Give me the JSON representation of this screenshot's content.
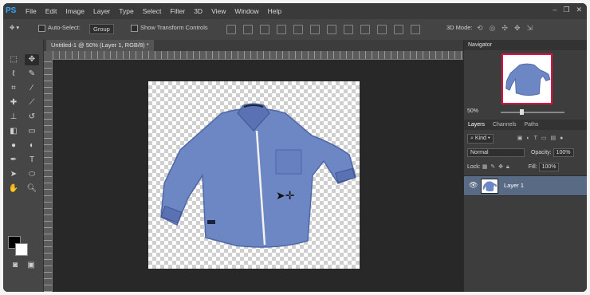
{
  "menubar": {
    "logo": "PS",
    "items": [
      "File",
      "Edit",
      "Image",
      "Layer",
      "Type",
      "Select",
      "Filter",
      "3D",
      "View",
      "Window",
      "Help"
    ]
  },
  "options": {
    "auto_select_label": "Auto-Select:",
    "auto_select_value": "Group",
    "show_transform_label": "Show Transform Controls",
    "mode3d_label": "3D Mode:"
  },
  "document": {
    "tab_title": "Untitled-1 @ 50% (Layer 1, RGB/8) *",
    "ruler_marks": [
      "6",
      "4",
      "2",
      "0",
      "2",
      "4",
      "6",
      "8",
      "10",
      "12",
      "14",
      "16",
      "18",
      "20",
      "22"
    ]
  },
  "navigator": {
    "title": "Navigator",
    "zoom": "50%"
  },
  "layers_panel": {
    "tabs": [
      "Layers",
      "Channels",
      "Paths"
    ],
    "kind_label": "Kind",
    "blend_mode": "Normal",
    "opacity_label": "Opacity:",
    "opacity_value": "100%",
    "lock_label": "Lock:",
    "fill_label": "Fill:",
    "fill_value": "100%",
    "layer_name": "Layer 1"
  },
  "colors": {
    "shirt": "#6d86c4",
    "shirt_dark": "#4f67a6",
    "selected_layer": "#596a85",
    "accent": "#31a8ff"
  },
  "icons": [
    "move-icon",
    "marquee-icon",
    "lasso-icon",
    "quick-select-icon",
    "crop-icon",
    "eyedropper-icon",
    "healing-brush-icon",
    "brush-icon",
    "clone-stamp-icon",
    "history-brush-icon",
    "eraser-icon",
    "gradient-icon",
    "blur-icon",
    "dodge-icon",
    "pen-icon",
    "type-icon",
    "path-select-icon",
    "shape-icon",
    "hand-icon",
    "zoom-icon",
    "eye-icon"
  ]
}
